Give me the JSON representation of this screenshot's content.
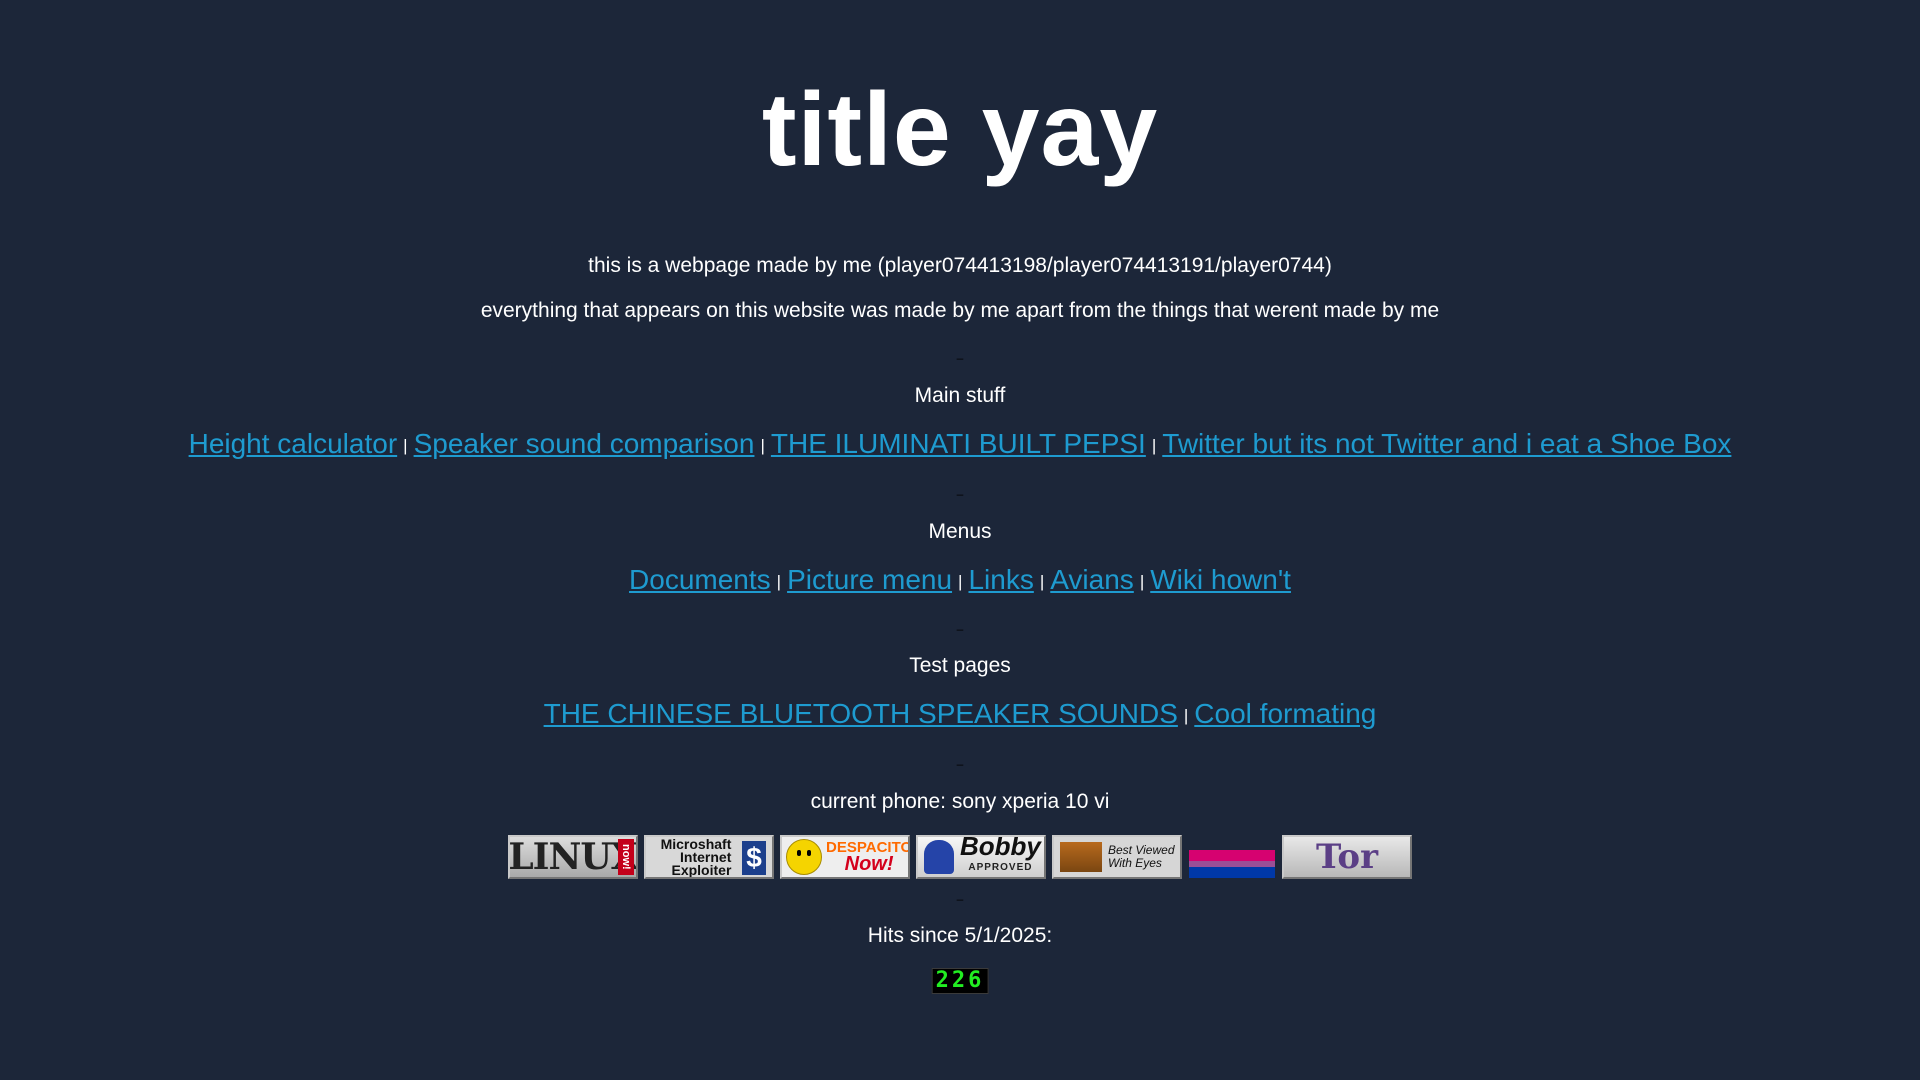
{
  "title": "title yay",
  "intro": {
    "line1": "this is a webpage made by me (player074413198/player074413191/player0744)",
    "line2": "everything that appears on this website was made by me apart from the things that werent made by me"
  },
  "separator": "–",
  "pipe": "|",
  "main_stuff": {
    "heading": "Main stuff",
    "links": [
      "Height calculator",
      "Speaker sound comparison",
      "THE ILUMINATI BUILT PEPSI",
      "Twitter but its not Twitter and i eat a Shoe Box"
    ]
  },
  "menus": {
    "heading": "Menus",
    "links": [
      "Documents",
      "Picture menu",
      "Links",
      "Avians",
      "Wiki hown't"
    ]
  },
  "test_pages": {
    "heading": "Test pages",
    "links": [
      "THE CHINESE BLUETOOTH SPEAKER SOUNDS",
      "Cool formating"
    ]
  },
  "phone": "current phone: sony xperia 10 vi",
  "badges": {
    "linux": {
      "text": "LINUX",
      "now": "now!",
      "icon": "linux-now-badge"
    },
    "ie": {
      "line1": "Microshaft",
      "line2": "Internet",
      "line3": "Exploiter",
      "symbol": "$",
      "icon": "microshaft-internet-exploiter-badge"
    },
    "despacito": {
      "line1": "DESPACITO",
      "line2": "Now!",
      "icon": "despacito-now-badge"
    },
    "bobby": {
      "title": "Bobby",
      "sub": "APPROVED",
      "icon": "bobby-approved-badge"
    },
    "eyes": {
      "line1": "Best Viewed",
      "line2": "With Eyes",
      "icon": "best-viewed-with-eyes-badge"
    },
    "flag": {
      "icon": "bi-flag-badge"
    },
    "tor": {
      "text": "Tor",
      "icon": "tor-badge"
    }
  },
  "hits": {
    "label": "Hits since 5/1/2025:",
    "count": "226"
  },
  "colors": {
    "background": "#1c2639",
    "link": "#1e9bd0",
    "text": "#ffffff",
    "counter_digits": "#22ee22"
  }
}
